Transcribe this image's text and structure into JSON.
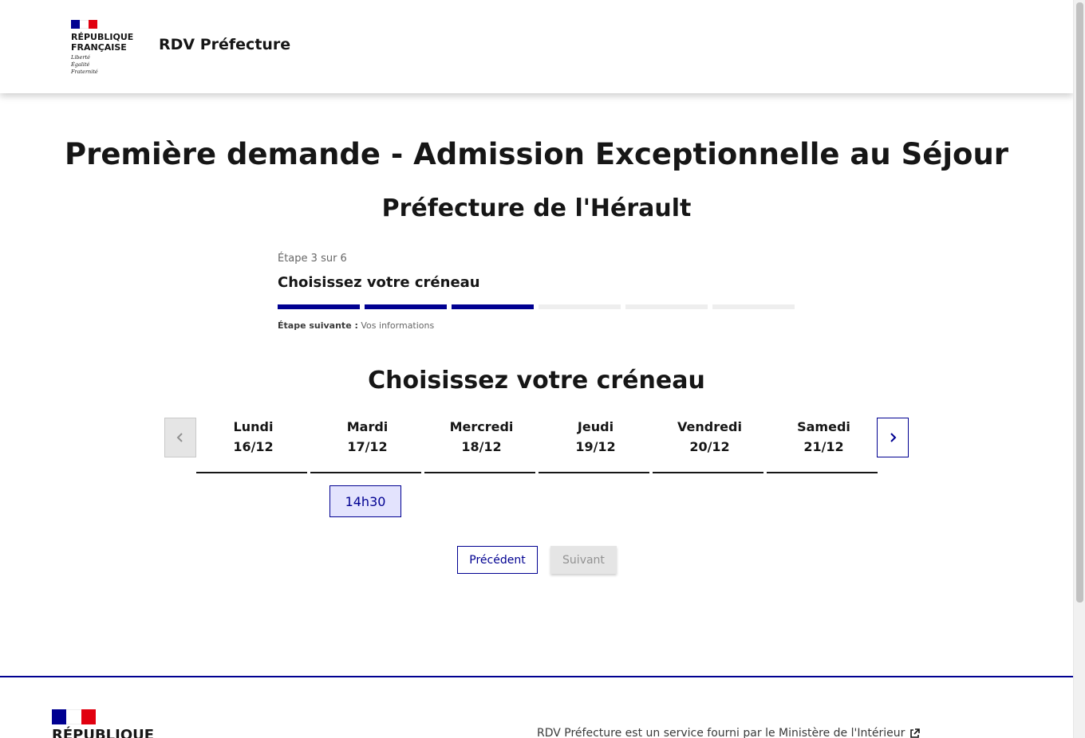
{
  "header": {
    "logo_lines": "RÉPUBLIQUE\nFRANÇAISE",
    "devise": "Liberté\nÉgalité\nFraternité",
    "service_title": "RDV Préfecture"
  },
  "main": {
    "title": "Première demande - Admission Exceptionnelle au Séjour",
    "subtitle": "Préfecture de l'Hérault",
    "stepper": {
      "state": "Étape 3 sur 6",
      "title": "Choisissez votre créneau",
      "current_step": 3,
      "total_steps": 6,
      "next_label": "Étape suivante :",
      "next_value": "Vos informations"
    },
    "section_title": "Choisissez votre créneau",
    "calendar": {
      "days": [
        {
          "name": "Lundi",
          "date": "16/12"
        },
        {
          "name": "Mardi",
          "date": "17/12"
        },
        {
          "name": "Mercredi",
          "date": "18/12"
        },
        {
          "name": "Jeudi",
          "date": "19/12"
        },
        {
          "name": "Vendredi",
          "date": "20/12"
        },
        {
          "name": "Samedi",
          "date": "21/12"
        }
      ],
      "slot": {
        "day": "Mardi",
        "time": "14h30"
      },
      "prev_icon": "chevron-left-icon",
      "next_icon": "chevron-right-icon"
    },
    "buttons": {
      "previous": "Précédent",
      "next": "Suivant"
    }
  },
  "footer": {
    "logo_text": "RÉPUBLIQUE",
    "description": "RDV Préfecture est un service fourni par le Ministère de l'Intérieur",
    "external_icon": "external-link-icon"
  },
  "colors": {
    "primary": "#000091",
    "slot_bg": "#e3e3fd",
    "flag_red": "#e1000f",
    "disabled_bg": "#e5e5e5"
  }
}
